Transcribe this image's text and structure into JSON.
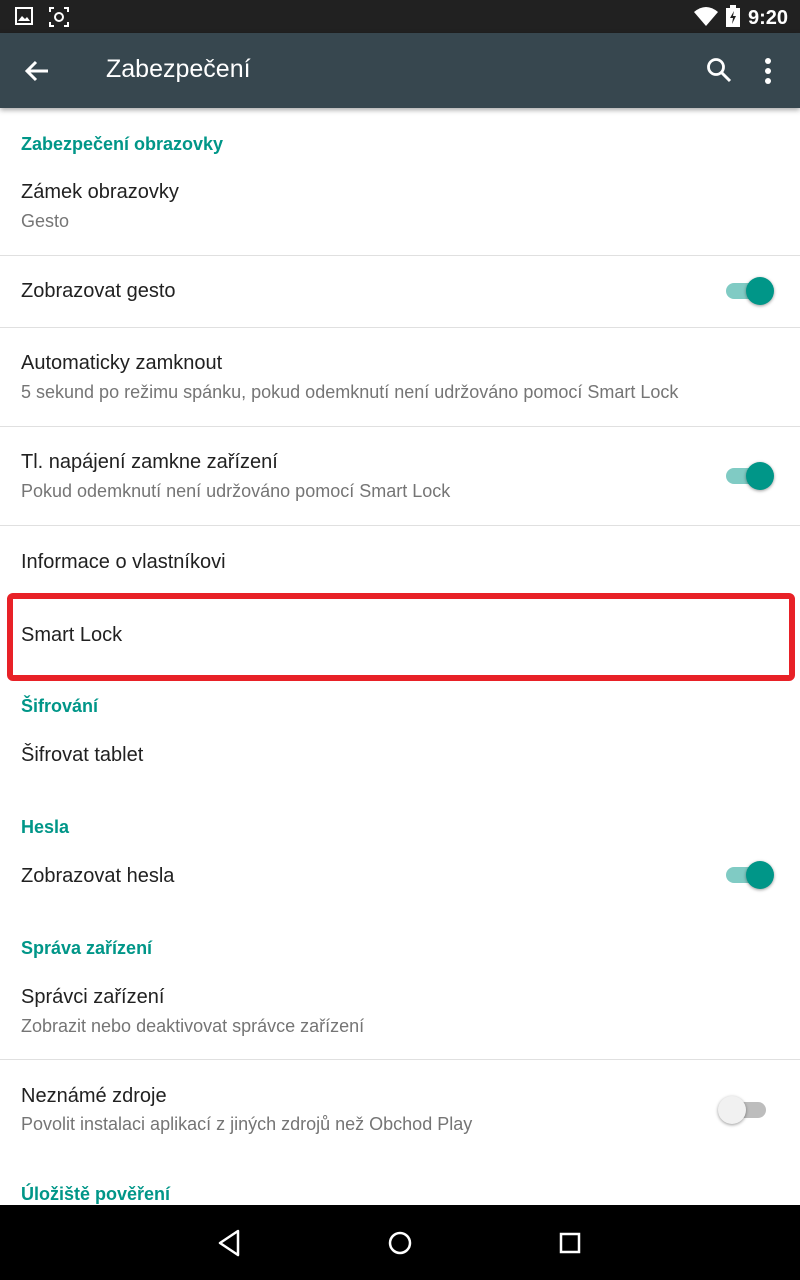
{
  "status_bar": {
    "time": "9:20",
    "icons": [
      "image-icon",
      "screenshot-icon",
      "wifi-icon",
      "battery-icon"
    ]
  },
  "toolbar": {
    "title": "Zabezpečení",
    "icons": [
      "back-arrow-icon",
      "search-icon",
      "more-vert-icon"
    ]
  },
  "sections": {
    "screen_security": "Zabezpečení obrazovky",
    "encryption": "Šifrování",
    "passwords": "Hesla",
    "device_admin": "Správa zařízení",
    "credential_storage": "Úložiště pověření"
  },
  "items": {
    "screen_lock": {
      "title": "Zámek obrazovky",
      "summary": "Gesto"
    },
    "show_pattern": {
      "title": "Zobrazovat gesto",
      "checked": true
    },
    "auto_lock": {
      "title": "Automaticky zamknout",
      "summary": "5 sekund po režimu spánku, pokud odemknutí není udržováno pomocí Smart Lock"
    },
    "power_lock": {
      "title": "Tl. napájení zamkne zařízení",
      "summary": "Pokud odemknutí není udržováno pomocí Smart Lock",
      "checked": true
    },
    "owner_info": {
      "title": "Informace o vlastníkovi"
    },
    "smart_lock": {
      "title": "Smart Lock",
      "highlight_color": "#e82127"
    },
    "encrypt_tablet": {
      "title": "Šifrovat tablet"
    },
    "show_passwords": {
      "title": "Zobrazovat hesla",
      "checked": true
    },
    "device_admins": {
      "title": "Správci zařízení",
      "summary": "Zobrazit nebo deaktivovat správce zařízení"
    },
    "unknown_sources": {
      "title": "Neznámé zdroje",
      "summary": "Povolit instalaci aplikací z jiných zdrojů než Obchod Play",
      "checked": false
    }
  },
  "colors": {
    "accent": "#009688",
    "toolbar": "#37474f",
    "status_bar": "#212121",
    "nav_bar": "#000000"
  },
  "nav_bar": {
    "icons": [
      "back-icon",
      "home-icon",
      "recents-icon"
    ]
  }
}
